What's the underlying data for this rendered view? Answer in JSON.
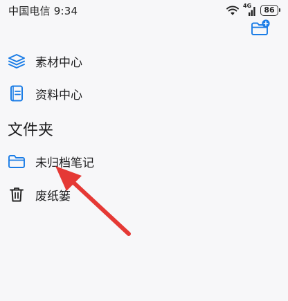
{
  "status_bar": {
    "carrier_time": "中国电信 9:34",
    "network_tag": "4G",
    "battery": "86"
  },
  "toolbar": {
    "new_folder_icon": "folder-plus-icon"
  },
  "nav": {
    "materials_label": "素材中心",
    "resources_label": "资料中心"
  },
  "folders": {
    "title": "文件夹",
    "unfiled_label": "未归档笔记",
    "trash_label": "废纸篓"
  },
  "colors": {
    "accent": "#1a7ce6",
    "arrow": "#e53935"
  }
}
